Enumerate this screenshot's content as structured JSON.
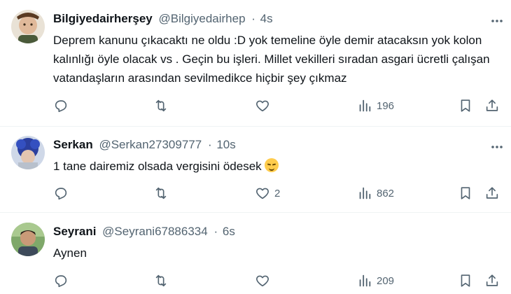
{
  "tweets": [
    {
      "display_name": "Bilgiyedairherşey",
      "handle": "@Bilgiyedairhep",
      "separator": "·",
      "time": "4s",
      "text": "Deprem kanunu çıkacaktı ne oldu :D yok temeline öyle demir atacaksın yok kolon kalınlığı öyle olacak vs . Geçin bu işleri.  Millet vekilleri sıradan asgari ücretli çalışan vatandaşların arasından sevilmedikce hiçbir şey çıkmaz",
      "likes": "",
      "views": "196"
    },
    {
      "display_name": "Serkan",
      "handle": "@Serkan27309777",
      "separator": "·",
      "time": "10s",
      "text": "1 tane dairemiz olsada vergisini ödesek",
      "emoji": "pensive-face-emoji",
      "likes": "2",
      "views": "862"
    },
    {
      "display_name": "Seyrani",
      "handle": "@Seyrani67886334",
      "separator": "·",
      "time": "6s",
      "text": "Aynen",
      "likes": "",
      "views": "209"
    }
  ],
  "icons": [
    "reply-icon",
    "retweet-icon",
    "like-icon",
    "views-icon",
    "bookmark-icon",
    "share-icon",
    "more-icon"
  ],
  "colors": {
    "text": "#0f1419",
    "secondary": "#536471",
    "divider": "#eff3f4",
    "background": "#ffffff"
  }
}
